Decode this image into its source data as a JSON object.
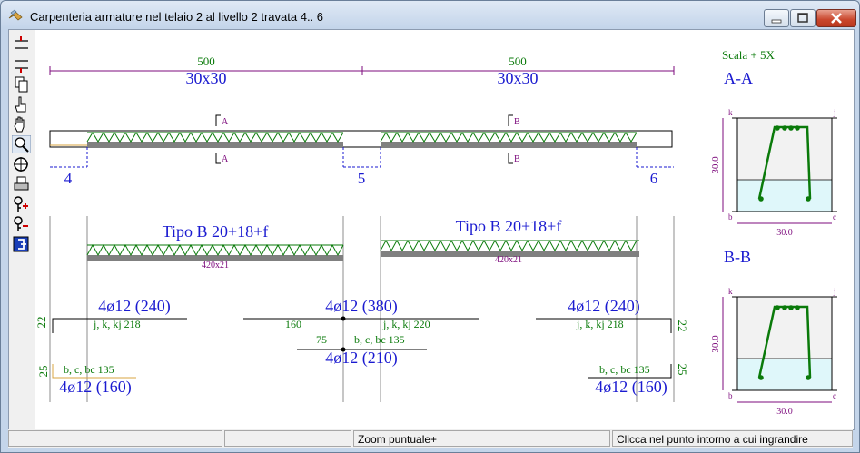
{
  "window": {
    "title": "Carpenteria armature nel telaio 2 al livello 2 travata  4.. 6"
  },
  "toolbar": {
    "buttons": [
      {
        "name": "dimension-top-icon"
      },
      {
        "name": "dimension-bottom-icon"
      },
      {
        "name": "copy-icon"
      },
      {
        "name": "hand-point-icon"
      },
      {
        "name": "pan-hand-icon"
      },
      {
        "name": "zoom-icon"
      },
      {
        "name": "target-icon"
      },
      {
        "name": "print-icon"
      },
      {
        "name": "key-plus-icon"
      },
      {
        "name": "key-minus-icon"
      },
      {
        "name": "exit-icon"
      }
    ]
  },
  "drawing": {
    "spans": [
      {
        "length": "500",
        "section": "30x30"
      },
      {
        "length": "500",
        "section": "30x30"
      }
    ],
    "nodes": [
      "4",
      "5",
      "6"
    ],
    "section_marks": [
      "A",
      "A",
      "B",
      "B"
    ],
    "slabs": [
      {
        "label": "Tipo B 20+18+f",
        "sub": "420x21"
      },
      {
        "label": "Tipo B 20+18+f",
        "sub": "420x21"
      }
    ],
    "top_rebars": [
      {
        "bars": "4ø12 (240)",
        "note": "j, k, kj 218"
      },
      {
        "bars": "4ø12 (380)",
        "left": "160",
        "note": "j, k, kj 220"
      },
      {
        "bars": "4ø12 (240)",
        "note": "j, k, kj 218"
      }
    ],
    "bottom_rebars": [
      {
        "bars": "4ø12 (160)",
        "note": "b, c, bc 135"
      },
      {
        "bars": "4ø12 (210)",
        "left": "75",
        "note": "b, c, bc 135"
      },
      {
        "bars": "4ø12 (160)",
        "note": "b, c, bc 135"
      }
    ],
    "dim_22": "22",
    "dim_25": "25",
    "scale": "Scala +  5X",
    "cross_sections": [
      {
        "title": "A-A",
        "height": "30.0",
        "width": "30.0",
        "corners": [
          "k",
          "j",
          "b",
          "c"
        ]
      },
      {
        "title": "B-B",
        "height": "30.0",
        "width": "30.0",
        "corners": [
          "k",
          "j",
          "b",
          "c"
        ]
      }
    ]
  },
  "statusbar": {
    "panel1": "",
    "panel2": "",
    "mode": "Zoom puntuale+",
    "hint": "Clicca nel punto intorno a cui ingrandire"
  },
  "colors": {
    "dim": "#7d0b7d",
    "blue_text": "#1a1ad0",
    "green": "#0a7a0a",
    "beam": "#808080",
    "section_fill": "#dff7fa"
  }
}
